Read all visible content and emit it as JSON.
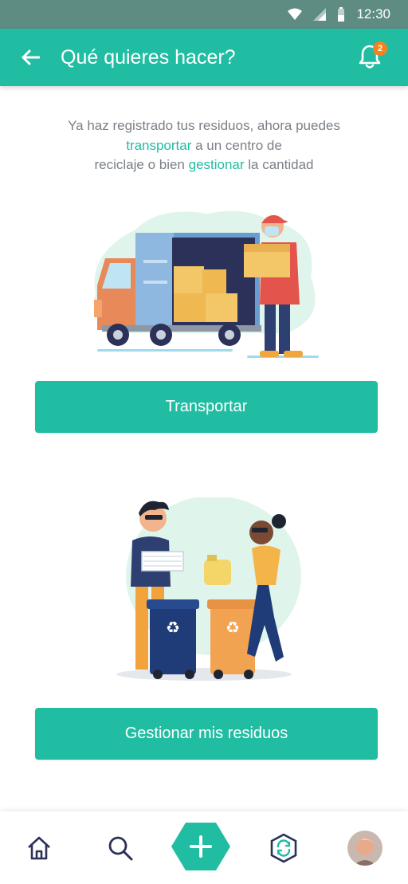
{
  "status_bar": {
    "time": "12:30"
  },
  "app_bar": {
    "title": "Qué quieres hacer?",
    "notification_count": "2"
  },
  "intro": {
    "line1": "Ya haz registrado tus residuos, ahora puedes",
    "link_transport": "transportar",
    "line2_rest": " a un centro de",
    "line3_start": "reciclaje o bien ",
    "link_manage": "gestionar",
    "line3_end": " la cantidad"
  },
  "actions": {
    "transport_label": "Transportar",
    "manage_label": "Gestionar mis residuos"
  },
  "bottom_nav": {
    "items": [
      "home-icon",
      "search-icon",
      "add-icon",
      "recycle-sync-icon",
      "profile-avatar"
    ]
  },
  "colors": {
    "primary": "#21bda3",
    "status_bar": "#5e8c83",
    "badge": "#f5821f",
    "text_muted": "#7a8087"
  }
}
